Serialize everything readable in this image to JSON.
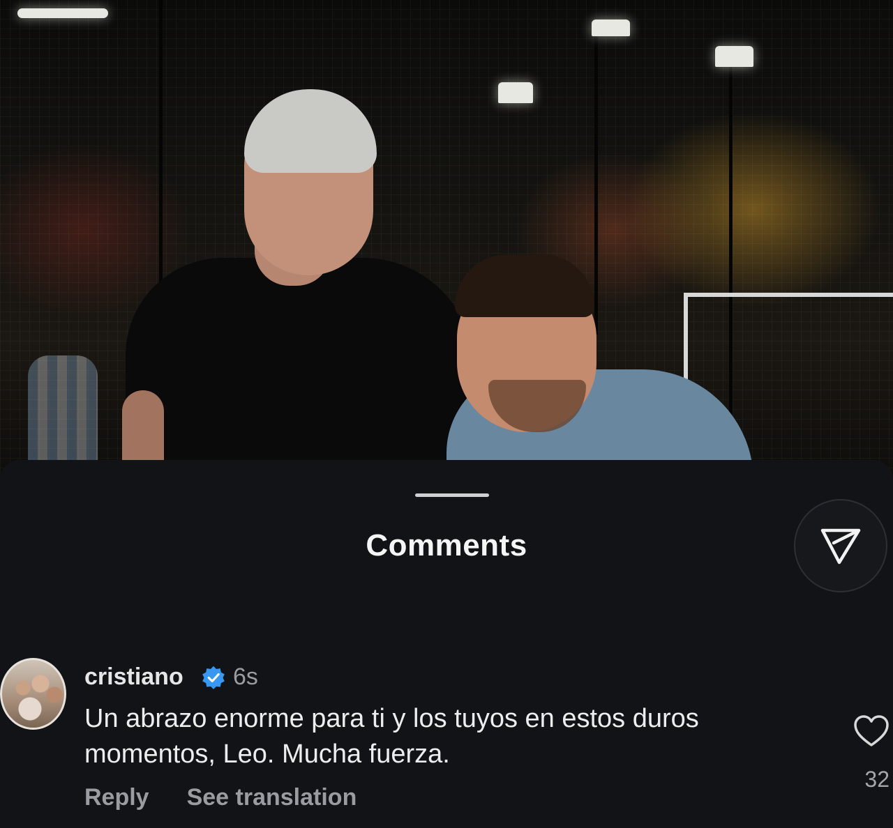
{
  "photo": {
    "description_icon": "post-photo"
  },
  "sheet": {
    "title": "Comments",
    "share_icon": "send-icon"
  },
  "comment": {
    "username": "cristiano",
    "verified_icon": "verified-badge-icon",
    "time": "6s",
    "text": "Un abrazo enorme para ti y los tuyos en estos duros momentos, Leo. Mucha fuerza.",
    "reply_label": "Reply",
    "translate_label": "See translation",
    "like_icon": "heart-icon",
    "like_count": "32"
  },
  "colors": {
    "sheet_bg": "#111317",
    "verified_blue": "#3897f0",
    "muted_text": "#9a9ca2"
  }
}
